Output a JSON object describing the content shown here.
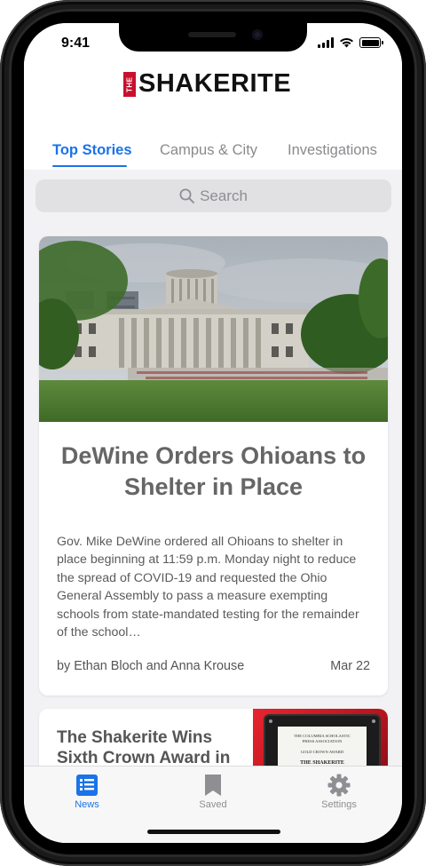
{
  "status_bar": {
    "time": "9:41"
  },
  "app": {
    "logo": {
      "prefix": "THE",
      "name": "SHAKERITE",
      "brand_color": "#c8102e"
    }
  },
  "tabs": [
    {
      "label": "Top Stories",
      "active": true
    },
    {
      "label": "Campus & City",
      "active": false
    },
    {
      "label": "Investigations",
      "active": false
    }
  ],
  "search": {
    "placeholder": "Search",
    "icon": "search-icon"
  },
  "articles": [
    {
      "image": "ohio-statehouse-photo",
      "title": "DeWine Orders Ohioans to Shelter in Place",
      "summary": "Gov. Mike DeWine ordered all Ohioans to shelter in place beginning at 11:59 p.m. Monday night to reduce the spread of COVID-19 and requested the Ohio General Assembly to pass a measure exempting schools from state-mandated testing for the remainder of the school…",
      "author": "by Ethan Bloch and Anna Krouse",
      "date": "Mar 22"
    },
    {
      "title": "The Shakerite Wins Sixth Crown Award in",
      "image": "gold-crown-award-plaque-photo",
      "plaque": {
        "line1": "THE COLUMBIA SCHOLASTIC",
        "line2": "PRESS ASSOCIATION",
        "line3": "GOLD CROWN AWARD",
        "name": "THE SHAKERITE"
      }
    }
  ],
  "tab_bar": [
    {
      "label": "News",
      "icon": "news-icon",
      "active": true
    },
    {
      "label": "Saved",
      "icon": "bookmark-icon",
      "active": false
    },
    {
      "label": "Settings",
      "icon": "gear-icon",
      "active": false
    }
  ],
  "colors": {
    "accent": "#1a73e8",
    "background": "#f2f2f4"
  }
}
